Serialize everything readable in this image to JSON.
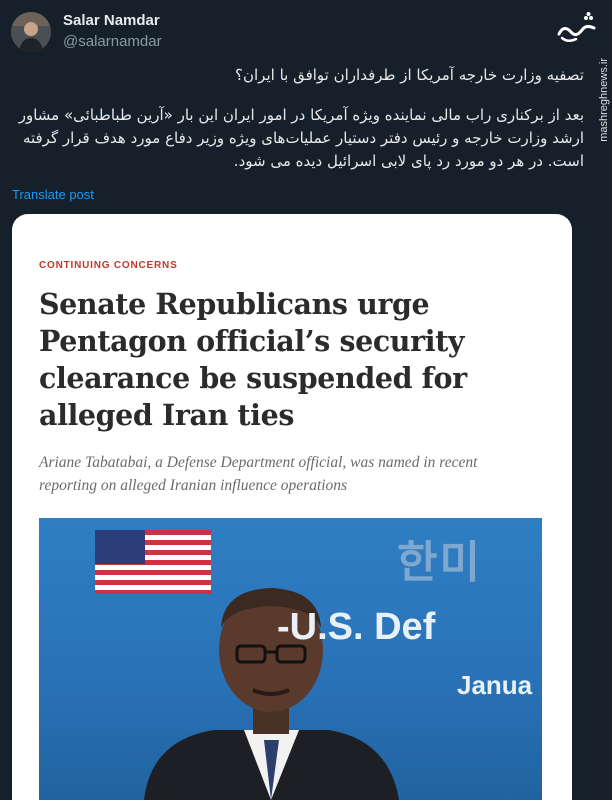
{
  "author": {
    "name": "Salar Namdar",
    "handle": "@salarnamdar"
  },
  "watermark": {
    "logo_text": "مشرق",
    "site": "mashreghnews.ir"
  },
  "tweet": {
    "paragraph1": "تصفیه وزارت خارجه آمریکا از طرفداران توافق با ایران؟",
    "paragraph2": "بعد از برکناری راب مالی نماینده ویژه آمریکا در امور ایران این بار «آرین طباطبائی» مشاور ارشد وزارت خارجه و رئیس دفتر دستیار عملیات‌های ویژه وزیر دفاع مورد هدف قرار گرفته است. در هر دو مورد رد پای لابی اسرائیل دیده می شود.",
    "translate_label": "Translate post"
  },
  "card": {
    "kicker": "CONTINUING CONCERNS",
    "headline": "Senate Republicans urge Pentagon official’s security clearance be suspended for alleged Iran ties",
    "dek": "Ariane Tabatabai, a Defense Department official, was named in recent reporting on alleged Iranian influence operations",
    "photo": {
      "korean_text": "한미",
      "line1": "-U.S. Def",
      "line2": "Janua"
    }
  },
  "colors": {
    "background": "#15202b",
    "link": "#1d9bf0",
    "kicker": "#c0392b"
  }
}
